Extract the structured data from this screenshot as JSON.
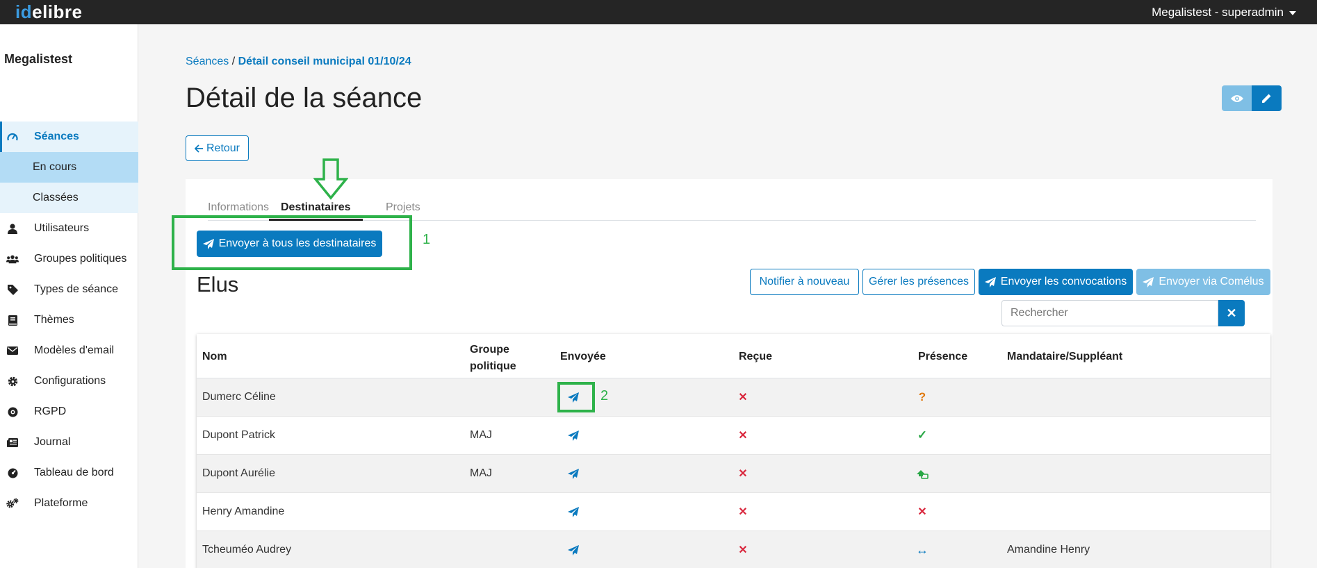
{
  "app": {
    "logo_id": "id",
    "logo_rest": "elibre",
    "user_menu": "Megalistest - superadmin"
  },
  "sidebar": {
    "brand": "Megalistest",
    "items": [
      {
        "label": "Séances",
        "icon": "gauge-icon"
      },
      {
        "label": "En cours"
      },
      {
        "label": "Classées"
      },
      {
        "label": "Utilisateurs",
        "icon": "user-icon"
      },
      {
        "label": "Groupes politiques",
        "icon": "users-icon"
      },
      {
        "label": "Types de séance",
        "icon": "tag-icon"
      },
      {
        "label": "Thèmes",
        "icon": "book-icon"
      },
      {
        "label": "Modèles d'email",
        "icon": "envelope-icon"
      },
      {
        "label": "Configurations",
        "icon": "gear-icon"
      },
      {
        "label": "RGPD",
        "icon": "shield-icon"
      },
      {
        "label": "Journal",
        "icon": "newspaper-icon"
      },
      {
        "label": "Tableau de bord",
        "icon": "dashboard-icon"
      },
      {
        "label": "Plateforme",
        "icon": "gears-icon"
      }
    ]
  },
  "breadcrumb": {
    "root": "Séances",
    "sep": "/",
    "current": "Détail conseil municipal 01/10/24"
  },
  "page": {
    "title": "Détail de la séance",
    "back_label": "Retour"
  },
  "tabs": [
    "Informations",
    "Destinataires",
    "Projets"
  ],
  "send_all_label": "Envoyer à tous les destinataires",
  "annotations": {
    "label1": "1",
    "label2": "2"
  },
  "elus": {
    "title": "Elus",
    "actions": {
      "notify_again": "Notifier à nouveau",
      "manage_presence": "Gérer les présences",
      "send_convocations": "Envoyer les convocations",
      "send_comelus": "Envoyer via Comélus"
    },
    "search_placeholder": "Rechercher",
    "columns": [
      "Nom",
      "Groupe politique",
      "Envoyée",
      "Reçue",
      "Présence",
      "Mandataire/Suppléant"
    ],
    "rows": [
      {
        "nom": "Dumerc Céline",
        "groupe": "",
        "envoyee": "send-icon",
        "recue": "cross-icon",
        "presence": "question-icon",
        "mandataire": ""
      },
      {
        "nom": "Dupont Patrick",
        "groupe": "MAJ",
        "envoyee": "send-icon",
        "recue": "cross-icon",
        "presence": "check-icon",
        "mandataire": ""
      },
      {
        "nom": "Dupont Aurélie",
        "groupe": "MAJ",
        "envoyee": "send-icon",
        "recue": "cross-icon",
        "presence": "remote-icon",
        "mandataire": ""
      },
      {
        "nom": "Henry Amandine",
        "groupe": "",
        "envoyee": "send-icon",
        "recue": "cross-icon",
        "presence": "cross-icon",
        "mandataire": ""
      },
      {
        "nom": "Tcheuméo Audrey",
        "groupe": "",
        "envoyee": "send-icon",
        "recue": "cross-icon",
        "presence": "arrows-icon",
        "mandataire": "Amandine Henry"
      }
    ]
  },
  "colors": {
    "primary": "#0a7abf",
    "primary_light": "#7fbfe5",
    "annotation_green": "#2eb24a",
    "danger": "#d9263c",
    "warning": "#e07a10",
    "success": "#28a745"
  }
}
